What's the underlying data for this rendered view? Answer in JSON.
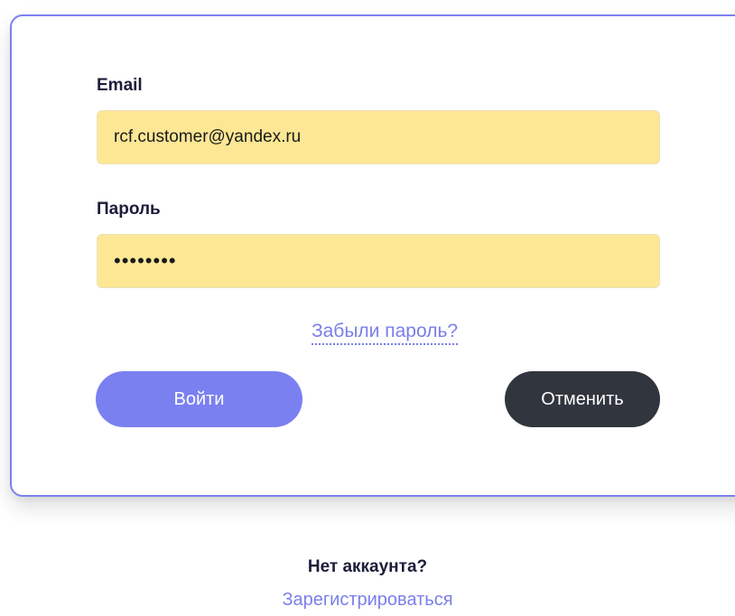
{
  "form": {
    "email_label": "Email",
    "email_value": "rcf.customer@yandex.ru",
    "password_label": "Пароль",
    "password_value": "••••••••",
    "forgot_link": "Забыли пароль?",
    "login_button": "Войти",
    "cancel_button": "Отменить"
  },
  "footer": {
    "no_account_text": "Нет аккаунта?",
    "register_link": "Зарегистрироваться"
  },
  "colors": {
    "accent": "#7b80f0",
    "field_bg": "#fde795",
    "dark_button": "#31353d",
    "text_dark": "#1b1d3a",
    "link": "#7a7fe8"
  }
}
